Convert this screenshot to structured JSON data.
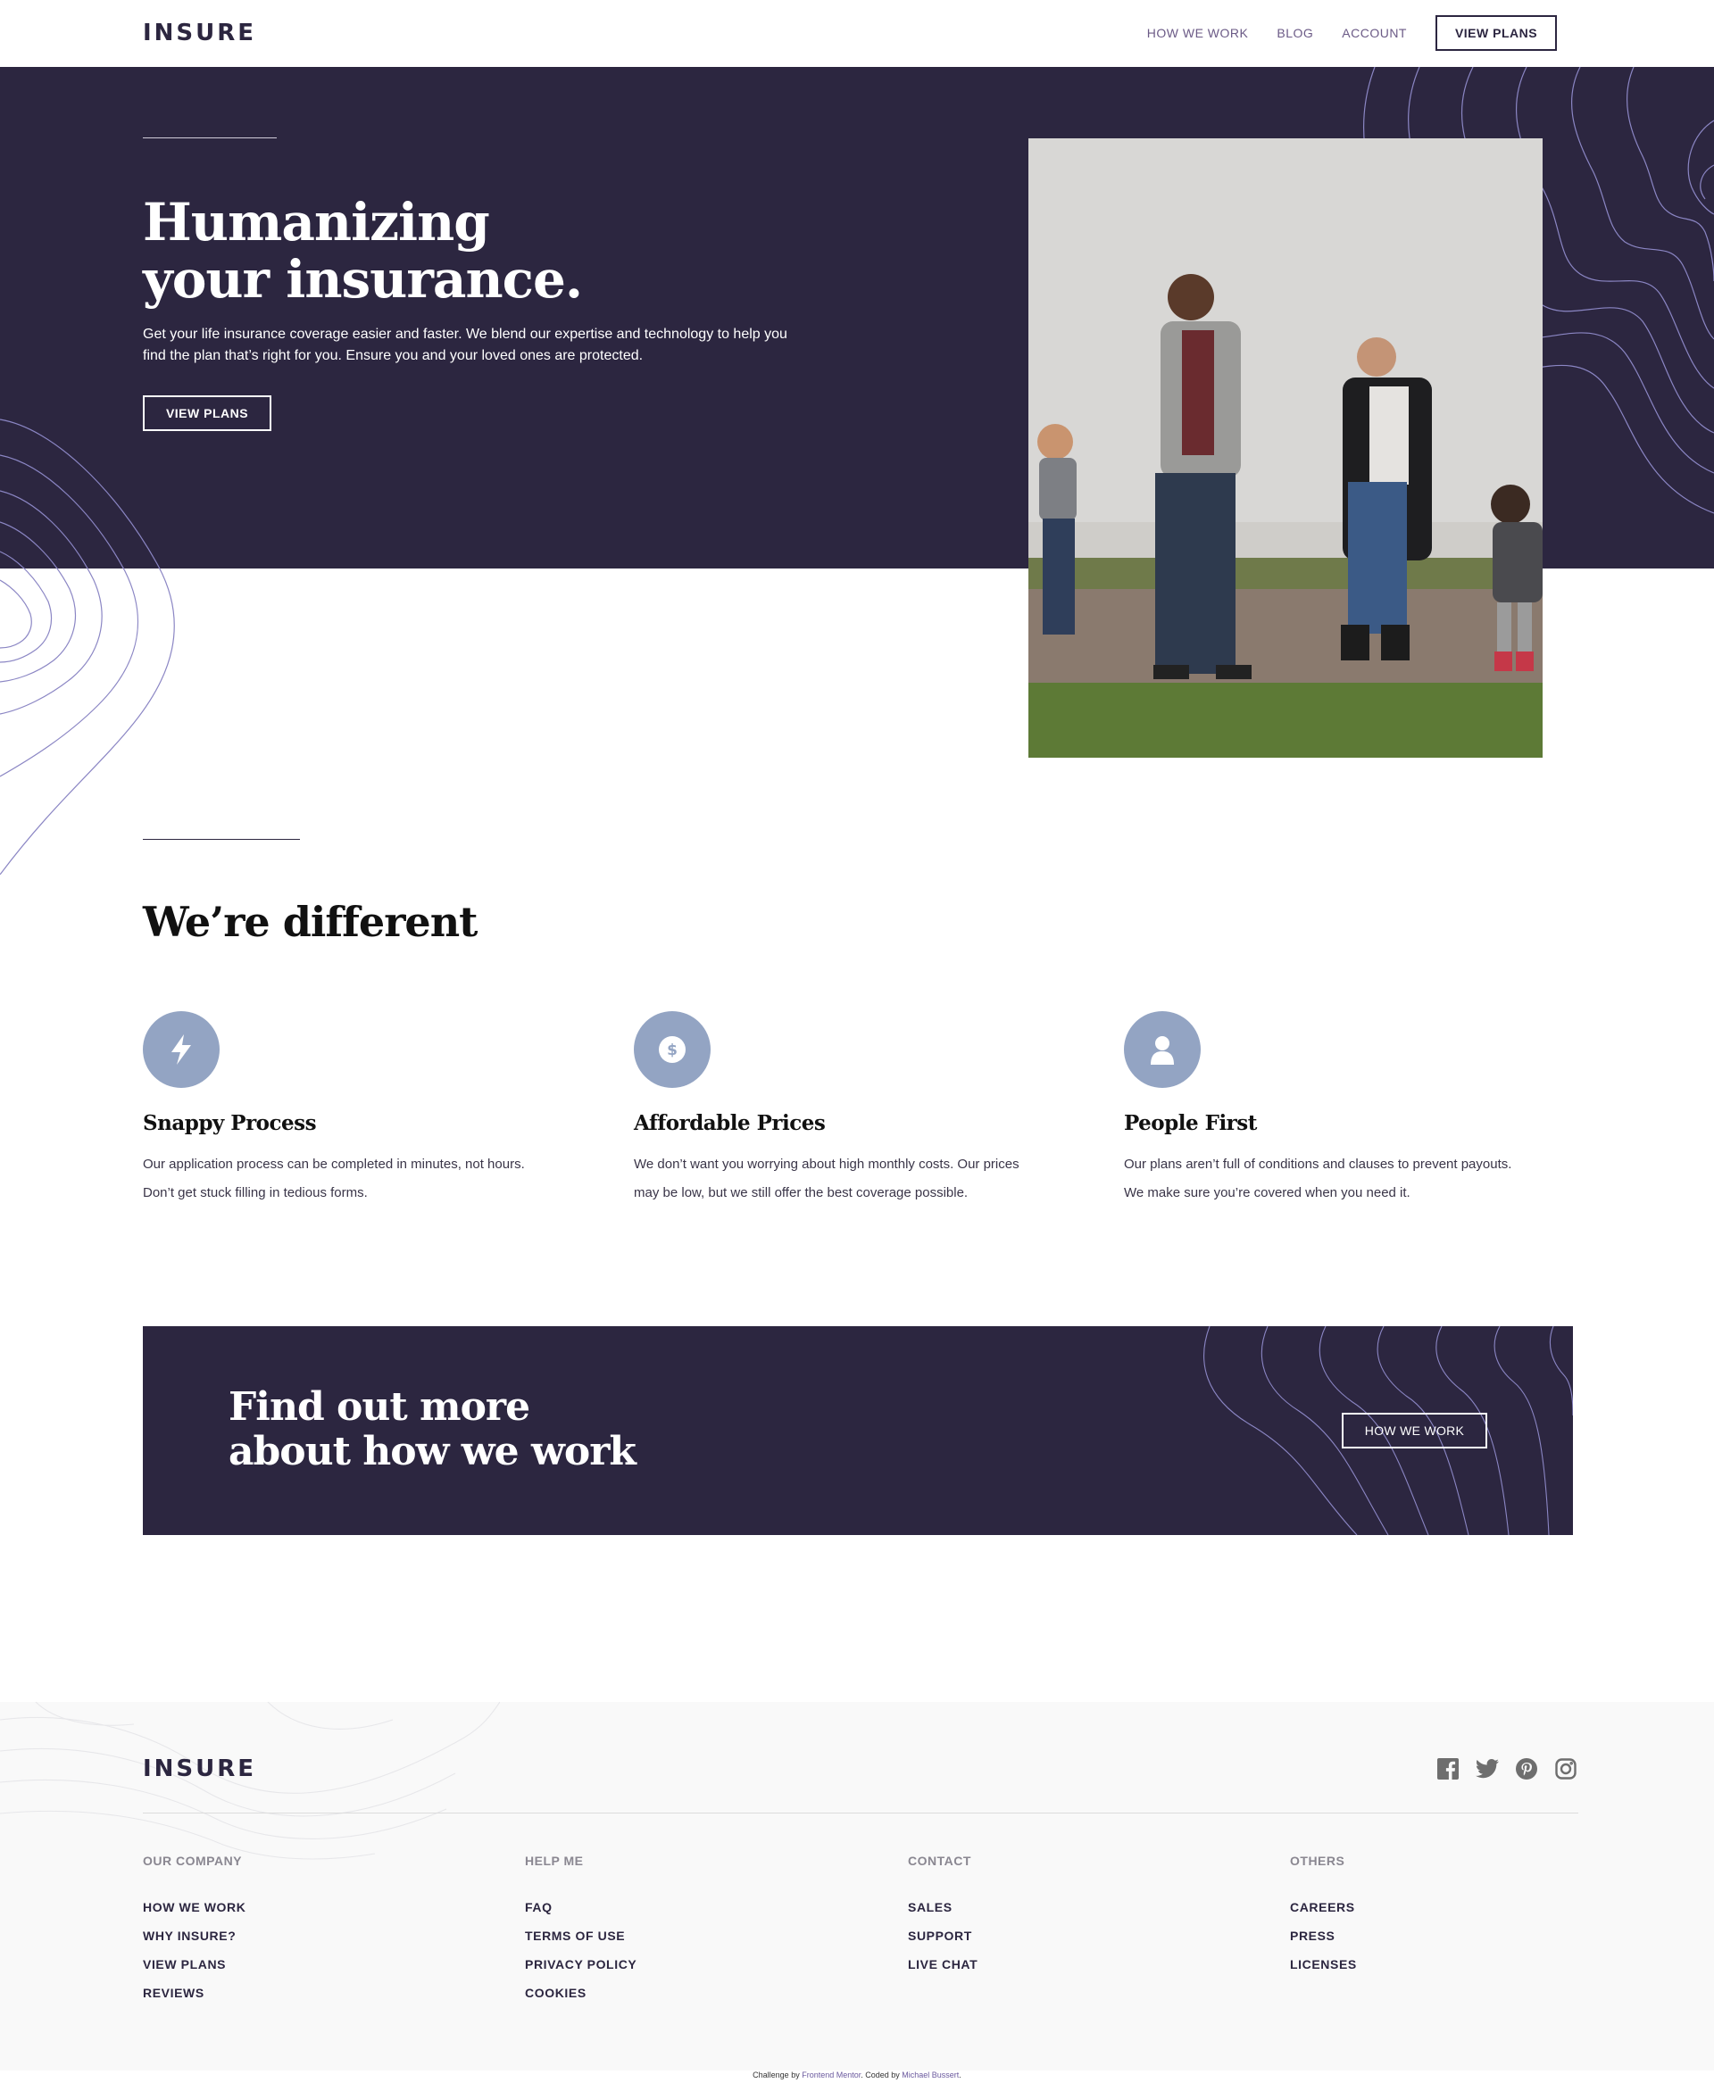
{
  "brand": {
    "logo": "INSURE"
  },
  "nav": {
    "links": [
      "HOW WE WORK",
      "BLOG",
      "ACCOUNT"
    ],
    "cta": "VIEW PLANS"
  },
  "hero": {
    "title_line1": "Humanizing",
    "title_line2": "your insurance.",
    "text_line1": "Get your life insurance coverage easier and faster. We blend our expertise and technology to help you",
    "text_line2": "find the plan that’s right for you. Ensure you and your loved ones are protected.",
    "button": "VIEW PLANS"
  },
  "different": {
    "title": "We’re different",
    "features": [
      {
        "icon": "lightning-bolt-icon",
        "title": "Snappy Process",
        "text_line1": "Our application process can be completed in minutes, not hours.",
        "text_line2": "Don’t get stuck filling in tedious forms."
      },
      {
        "icon": "dollar-coin-icon",
        "title": "Affordable Prices",
        "text_line1": "We don’t want you worrying about high monthly costs. Our prices",
        "text_line2": "may be low, but we still offer the best coverage possible."
      },
      {
        "icon": "person-icon",
        "title": "People First",
        "text_line1": "Our plans aren’t full of conditions and clauses to prevent payouts.",
        "text_line2": "We make sure you’re covered when you need it."
      }
    ]
  },
  "cta": {
    "title_line1": "Find out more",
    "title_line2": "about how we work",
    "button": "HOW WE WORK"
  },
  "footer": {
    "logo": "INSURE",
    "socials": [
      "facebook-icon",
      "twitter-icon",
      "pinterest-icon",
      "instagram-icon"
    ],
    "columns": [
      {
        "heading": "OUR COMPANY",
        "items": [
          "HOW WE WORK",
          "WHY INSURE?",
          "VIEW PLANS",
          "REVIEWS"
        ]
      },
      {
        "heading": "HELP ME",
        "items": [
          "FAQ",
          "TERMS OF USE",
          "PRIVACY POLICY",
          "COOKIES"
        ]
      },
      {
        "heading": "CONTACT",
        "items": [
          "SALES",
          "SUPPORT",
          "LIVE CHAT"
        ]
      },
      {
        "heading": "OTHERS",
        "items": [
          "CAREERS",
          "PRESS",
          "LICENSES"
        ]
      }
    ]
  },
  "attribution": {
    "prefix": "Challenge by ",
    "link1": "Frontend Mentor",
    "middle": ". Coded by ",
    "link2": "Michael Bussert",
    "suffix": "."
  },
  "colors": {
    "dark_violet": "#2c2640",
    "icon_blue": "#93a4c3",
    "footer_bg": "#f9f9f9",
    "nav_link": "#6b5a86",
    "wave_line": "#8b86c4"
  }
}
